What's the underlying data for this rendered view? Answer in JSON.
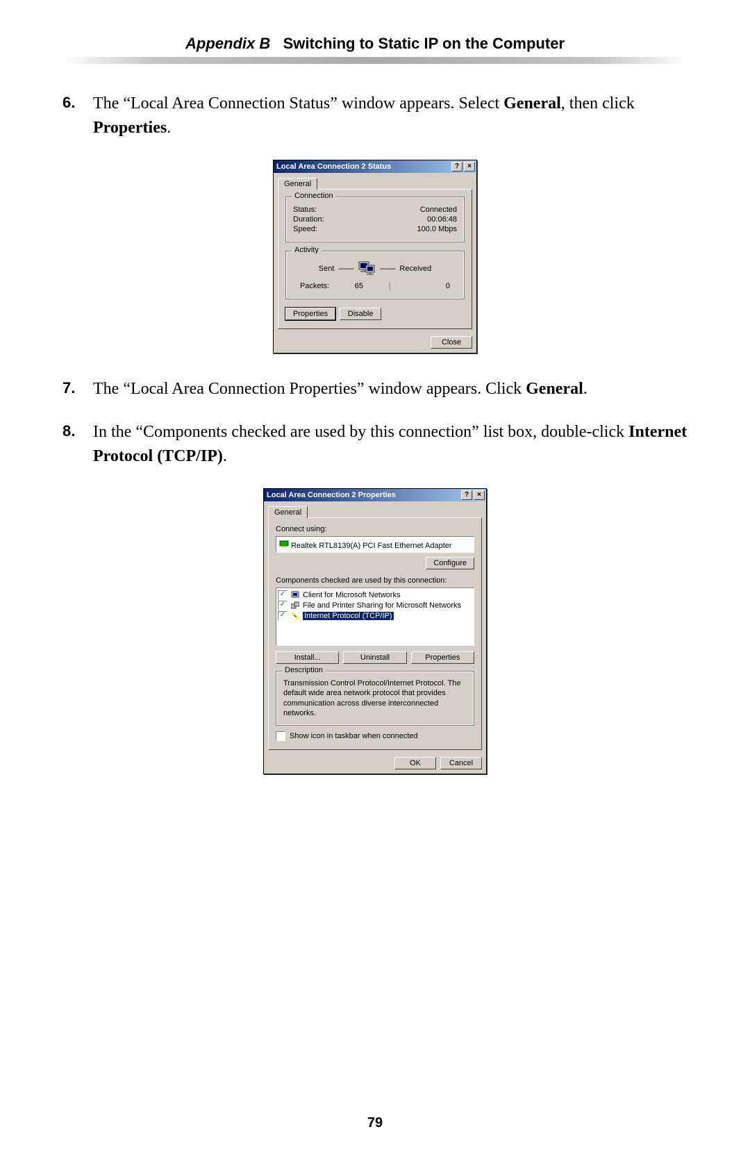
{
  "header": {
    "appendix": "Appendix B",
    "title": "Switching to Static IP on the Computer"
  },
  "page_number": "79",
  "steps": [
    {
      "num": "6.",
      "pre": "The “Local Area Connection Status” window appears. Select ",
      "bold1": "General",
      "mid": ", then click ",
      "bold2": "Properties",
      "post": "."
    },
    {
      "num": "7.",
      "pre": "The “Local Area Connection Properties” window appears. Click ",
      "bold1": "General",
      "mid": "",
      "bold2": "",
      "post": "."
    },
    {
      "num": "8.",
      "pre": "In the “Components checked are used by this connection” list box, double-click ",
      "bold1": "Internet Protocol (TCP/IP)",
      "mid": "",
      "bold2": "",
      "post": "."
    }
  ],
  "status_dialog": {
    "title": "Local Area Connection 2 Status",
    "help": "?",
    "close": "×",
    "tab": "General",
    "group_connection": "Connection",
    "status_label": "Status:",
    "status_value": "Connected",
    "duration_label": "Duration:",
    "duration_value": "00:06:48",
    "speed_label": "Speed:",
    "speed_value": "100.0 Mbps",
    "group_activity": "Activity",
    "sent_label": "Sent",
    "received_label": "Received",
    "packets_label": "Packets:",
    "packets_sent": "65",
    "packets_received": "0",
    "btn_properties": "Properties",
    "btn_disable": "Disable",
    "btn_close": "Close"
  },
  "props_dialog": {
    "title": "Local Area Connection 2 Properties",
    "help": "?",
    "close": "×",
    "tab": "General",
    "connect_using_label": "Connect using:",
    "adapter": "Realtek RTL8139(A) PCI Fast Ethernet Adapter",
    "btn_configure": "Configure",
    "components_label": "Components checked are used by this connection:",
    "items": [
      {
        "checked": true,
        "icon": "client-icon",
        "label": "Client for Microsoft Networks"
      },
      {
        "checked": true,
        "icon": "service-icon",
        "label": "File and Printer Sharing for Microsoft Networks"
      },
      {
        "checked": true,
        "icon": "protocol-icon",
        "label": "Internet Protocol (TCP/IP)",
        "selected": true
      }
    ],
    "btn_install": "Install...",
    "btn_uninstall": "Uninstall",
    "btn_properties": "Properties",
    "group_description": "Description",
    "description_text": "Transmission Control Protocol/Internet Protocol. The default wide area network protocol that provides communication across diverse interconnected networks.",
    "show_icon_label": "Show icon in taskbar when connected",
    "btn_ok": "OK",
    "btn_cancel": "Cancel"
  }
}
